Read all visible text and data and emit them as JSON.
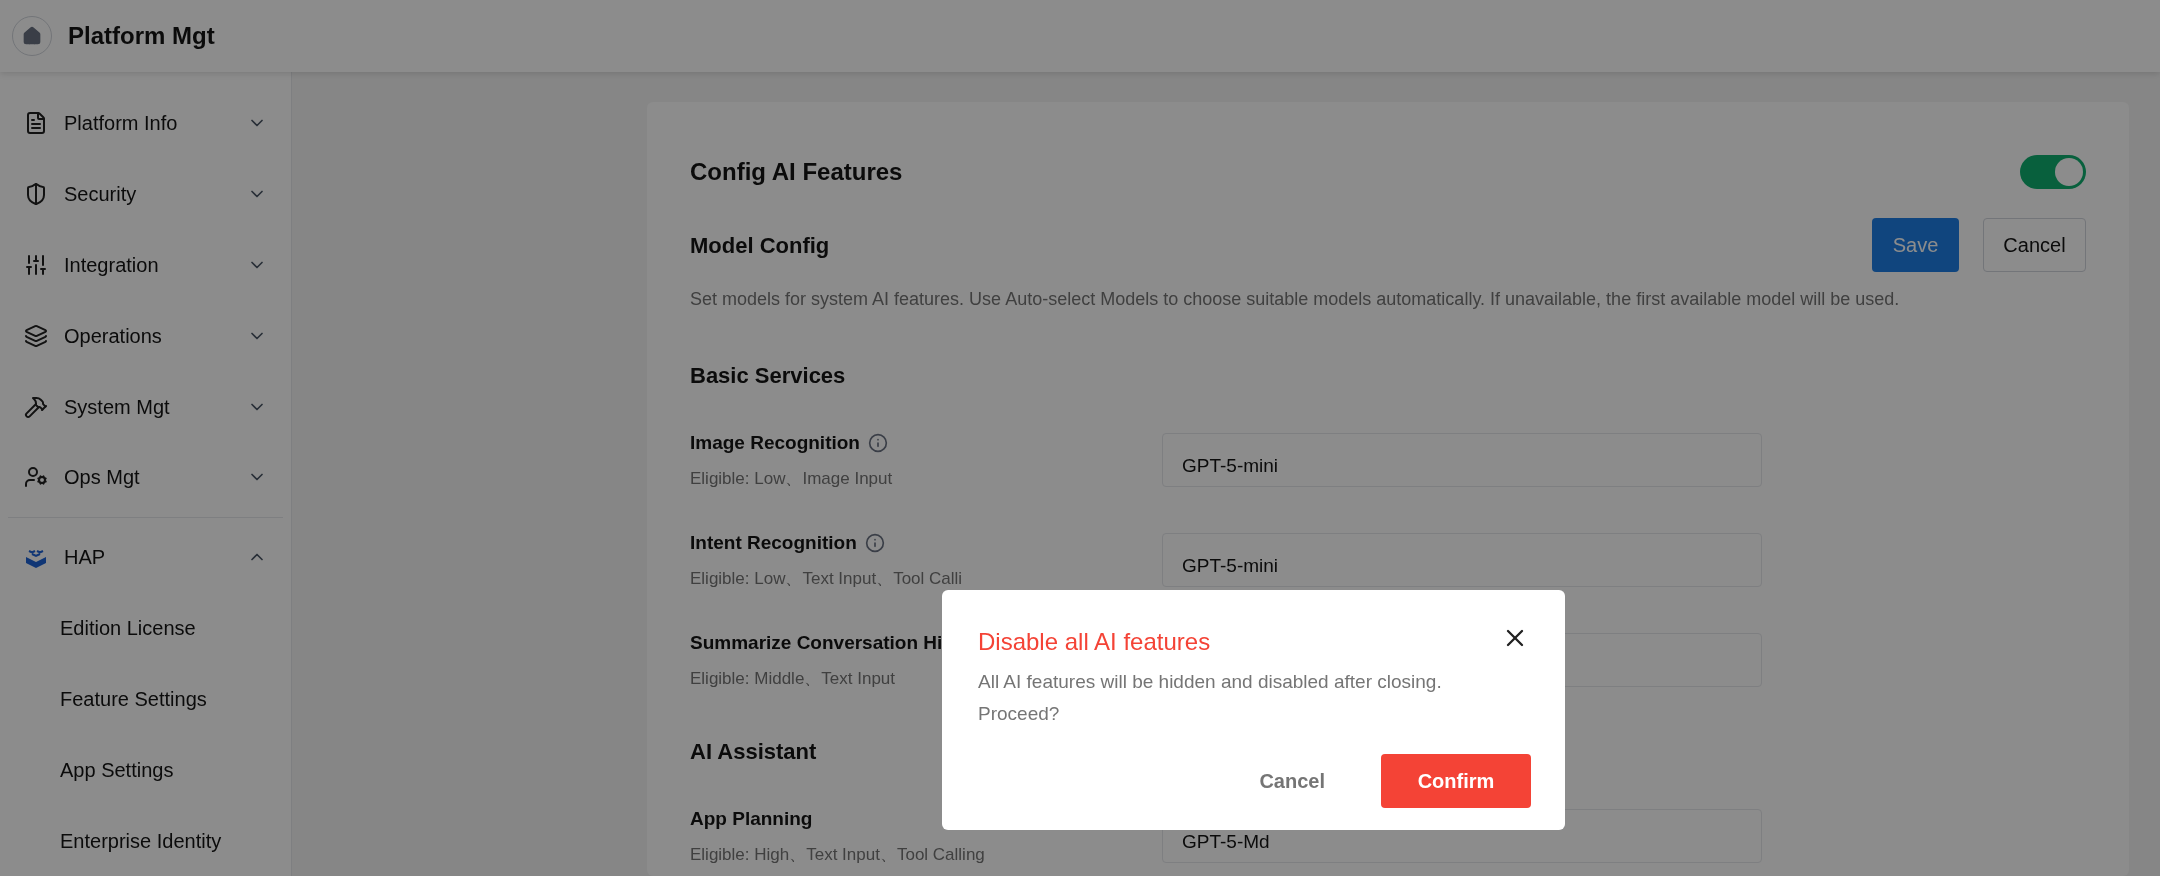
{
  "header": {
    "title": "Platform Mgt"
  },
  "sidebar": {
    "groups": [
      {
        "label": "Platform Info",
        "expanded": false
      },
      {
        "label": "Security",
        "expanded": false
      },
      {
        "label": "Integration",
        "expanded": false
      },
      {
        "label": "Operations",
        "expanded": false
      },
      {
        "label": "System Mgt",
        "expanded": false
      },
      {
        "label": "Ops Mgt",
        "expanded": false
      }
    ],
    "product": {
      "label": "HAP",
      "expanded": true,
      "children": [
        "Edition License",
        "Feature Settings",
        "App Settings",
        "Enterprise Identity"
      ]
    }
  },
  "card": {
    "title": "Config AI Features",
    "toggle_on": true,
    "section_title": "Model Config",
    "save": "Save",
    "cancel": "Cancel",
    "description": "Set models for system AI features. Use Auto-select Models to choose suitable models automatically. If unavailable, the first available model will be used.",
    "groups": [
      {
        "title": "Basic Services",
        "rows": [
          {
            "label": "Image Recognition",
            "info": true,
            "eligible": "Eligible: Low、Image Input",
            "value": "GPT-5-mini"
          },
          {
            "label": "Intent Recognition",
            "info": true,
            "eligible": "Eligible: Low、Text Input、Tool Calli",
            "value": "GPT-5-mini"
          },
          {
            "label": "Summarize Conversation Hi",
            "info": false,
            "eligible": "Eligible: Middle、Text Input"
          }
        ]
      },
      {
        "title": "AI Assistant",
        "rows": [
          {
            "label": "App Planning",
            "info": false,
            "eligible": "Eligible: High、Text Input、Tool Calling",
            "value": "GPT-5-Md"
          }
        ]
      }
    ]
  },
  "dialog": {
    "title": "Disable all AI features",
    "message": "All AI features will be hidden and disabled after closing. Proceed?",
    "cancel": "Cancel",
    "confirm": "Confirm"
  }
}
